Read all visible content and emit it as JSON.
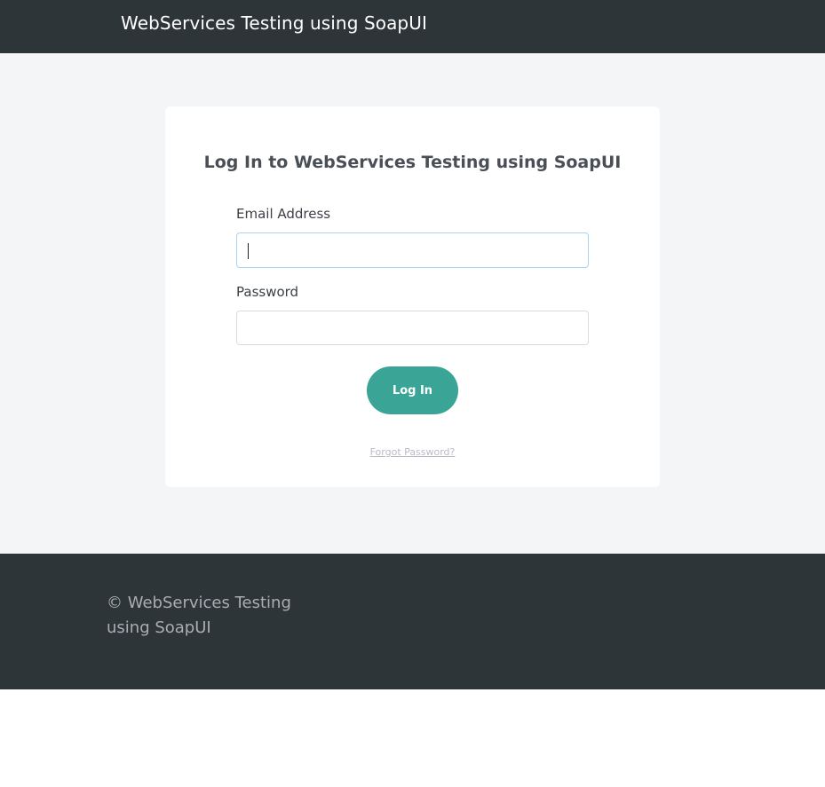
{
  "header": {
    "site_title": "WebServices Testing using SoapUI"
  },
  "login": {
    "title": "Log In to WebServices Testing using SoapUI",
    "email_label": "Email Address",
    "email_value": "",
    "password_label": "Password",
    "password_value": "",
    "submit_label": "Log In",
    "forgot_label": "Forgot Password?"
  },
  "footer": {
    "copyright": "© WebServices Testing using SoapUI"
  },
  "colors": {
    "header_bg": "#2d3538",
    "page_bg": "#f4f5f7",
    "accent": "#3aa597",
    "footer_bg": "#2d3538"
  }
}
